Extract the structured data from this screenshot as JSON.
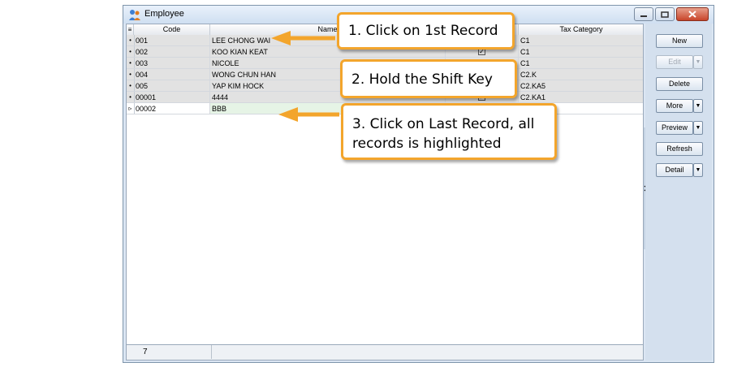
{
  "window": {
    "title": "Employee"
  },
  "grid": {
    "columns": [
      "Code",
      "Name",
      "Tax Category"
    ],
    "rows": [
      {
        "indicator": "•",
        "code": "001",
        "name": "LEE CHONG WAI",
        "checked": false,
        "tax": "C1"
      },
      {
        "indicator": "•",
        "code": "002",
        "name": "KOO KIAN KEAT",
        "checked": true,
        "tax": "C1"
      },
      {
        "indicator": "•",
        "code": "003",
        "name": "NICOLE",
        "checked": false,
        "tax": "C1"
      },
      {
        "indicator": "•",
        "code": "004",
        "name": "WONG CHUN HAN",
        "checked": false,
        "tax": "C2.K"
      },
      {
        "indicator": "•",
        "code": "005",
        "name": "YAP KIM HOCK",
        "checked": false,
        "tax": "C2.KA5"
      },
      {
        "indicator": "•",
        "code": "00001",
        "name": "4444",
        "checked": true,
        "tax": "C2.KA1"
      },
      {
        "indicator": "▹",
        "code": "00002",
        "name": "BBB",
        "checked": false,
        "tax": ""
      }
    ],
    "record_count": "7"
  },
  "buttons": {
    "new": "New",
    "edit": "Edit",
    "delete": "Delete",
    "more": "More",
    "preview": "Preview",
    "refresh": "Refresh",
    "detail": "Detail"
  },
  "callouts": {
    "step1": "1. Click on 1st Record",
    "step2": "2. Hold the Shift Key",
    "step3_line1": "3. Click on Last Record, all",
    "step3_line2": "records is highlighted"
  },
  "colors": {
    "callout_border": "#f3a52c",
    "arrow": "#f3a52c"
  }
}
